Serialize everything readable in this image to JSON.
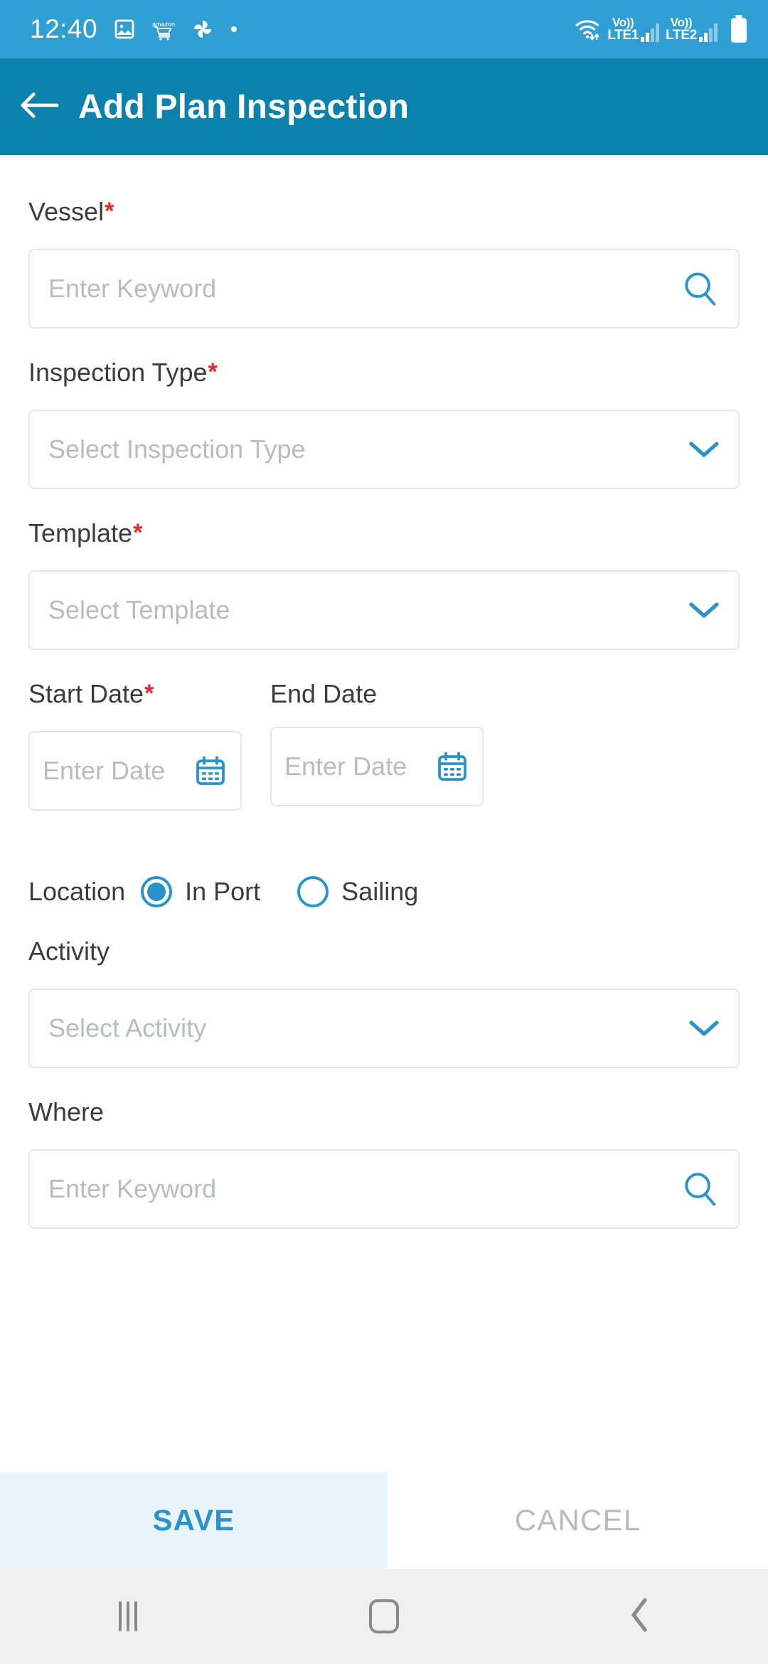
{
  "status_bar": {
    "time": "12:40",
    "icons_left": [
      "gallery-icon",
      "amazon-cart-icon",
      "pinwheel-icon",
      "dot-icon"
    ],
    "wifi": "wifi-icon",
    "sim1": {
      "volte": "Vo))",
      "network": "LTE1"
    },
    "sim2": {
      "volte": "Vo))",
      "network": "LTE2"
    },
    "battery": "battery-icon",
    "background": "#2f9fd4"
  },
  "app_bar": {
    "back_icon": "back-arrow-icon",
    "title": "Add Plan Inspection",
    "background": "#0b82ab"
  },
  "form": {
    "vessel": {
      "label": "Vessel",
      "required": true,
      "required_marker": "*",
      "placeholder": "Enter Keyword",
      "value": "",
      "trailing_icon": "search-icon"
    },
    "inspection_type": {
      "label": "Inspection Type",
      "required": true,
      "required_marker": "*",
      "placeholder": "Select Inspection Type",
      "value": "",
      "trailing_icon": "chevron-down-icon"
    },
    "template": {
      "label": "Template",
      "required": true,
      "required_marker": "*",
      "placeholder": "Select Template",
      "value": "",
      "trailing_icon": "chevron-down-icon"
    },
    "start_date": {
      "label": "Start Date",
      "required": true,
      "required_marker": "*",
      "placeholder": "Enter Date",
      "value": "",
      "trailing_icon": "calendar-icon"
    },
    "end_date": {
      "label": "End Date",
      "required": false,
      "placeholder": "Enter Date",
      "value": "",
      "trailing_icon": "calendar-icon"
    },
    "location": {
      "label": "Location",
      "options": [
        {
          "label": "In Port",
          "selected": true
        },
        {
          "label": "Sailing",
          "selected": false
        }
      ]
    },
    "activity": {
      "label": "Activity",
      "required": false,
      "placeholder": "Select Activity",
      "value": "",
      "trailing_icon": "chevron-down-icon"
    },
    "where": {
      "label": "Where",
      "required": false,
      "placeholder": "Enter Keyword",
      "value": "",
      "trailing_icon": "search-icon"
    }
  },
  "actions": {
    "save_label": "SAVE",
    "cancel_label": "CANCEL",
    "save_bg": "#e9f4fa",
    "save_color": "#2a93c9",
    "cancel_color": "#b9bcbe"
  },
  "nav_bar": {
    "recents": "recents-icon",
    "home": "home-icon",
    "back": "back-icon",
    "background": "#f0f0f0"
  },
  "theme": {
    "accent": "#2a93c9",
    "appbar": "#0b82ab",
    "statusbar": "#2f9fd4",
    "required_red": "#e8262c",
    "placeholder_gray": "#b9bcbe",
    "border_gray": "#e4e6e8"
  }
}
